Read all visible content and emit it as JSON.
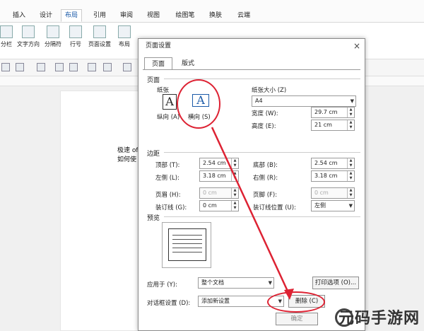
{
  "ribbon": {
    "tabs": [
      "插入",
      "设计",
      "布局",
      "引用",
      "审阅",
      "视图",
      "绘图笔",
      "换肤",
      "云端"
    ],
    "active_tab": "布局",
    "buttons": [
      "分栏",
      "文字方向",
      "分隔符",
      "行号",
      "页面设置",
      "布局"
    ]
  },
  "document": {
    "line1": "极速 of",
    "line2": "如何使"
  },
  "dialog": {
    "title": "页面设置",
    "close": "×",
    "tabs": [
      "页面",
      "版式"
    ],
    "section_page": "页面",
    "paper_label": "纸张",
    "orientation_portrait": "纵向 (A)",
    "orientation_landscape": "横向 (S)",
    "paper_size_label": "纸张大小 (Z)",
    "paper_size_value": "A4",
    "width_label": "宽度 (W):",
    "width_value": "29.7 cm",
    "height_label": "高度 (E):",
    "height_value": "21 cm",
    "section_margins": "边距",
    "top_label": "顶部 (T):",
    "top_value": "2.54 cm",
    "bottom_label": "底部 (B):",
    "bottom_value": "2.54 cm",
    "left_label": "左侧 (L):",
    "left_value": "3.18 cm",
    "right_label": "右侧 (R):",
    "right_value": "3.18 cm",
    "header_label": "页眉 (H):",
    "header_value": "0 cm",
    "footer_label": "页脚 (F):",
    "footer_value": "0 cm",
    "gutter_label": "装订线 (G):",
    "gutter_value": "0 cm",
    "gutter_pos_label": "装订线位置 (U):",
    "gutter_pos_value": "左侧",
    "section_preview": "预览",
    "apply_label": "应用于 (Y):",
    "apply_value": "整个文档",
    "print_options": "打印选项 (O)...",
    "dialog_settings_label": "对话框设置 (D):",
    "dialog_settings_value": "添加新设置",
    "delete_btn": "删除 (C)",
    "ok_btn": "确定"
  },
  "watermark": "元码手游网",
  "colors": {
    "annotation": "#dd2233",
    "active_tab": "#1a5aa8"
  }
}
